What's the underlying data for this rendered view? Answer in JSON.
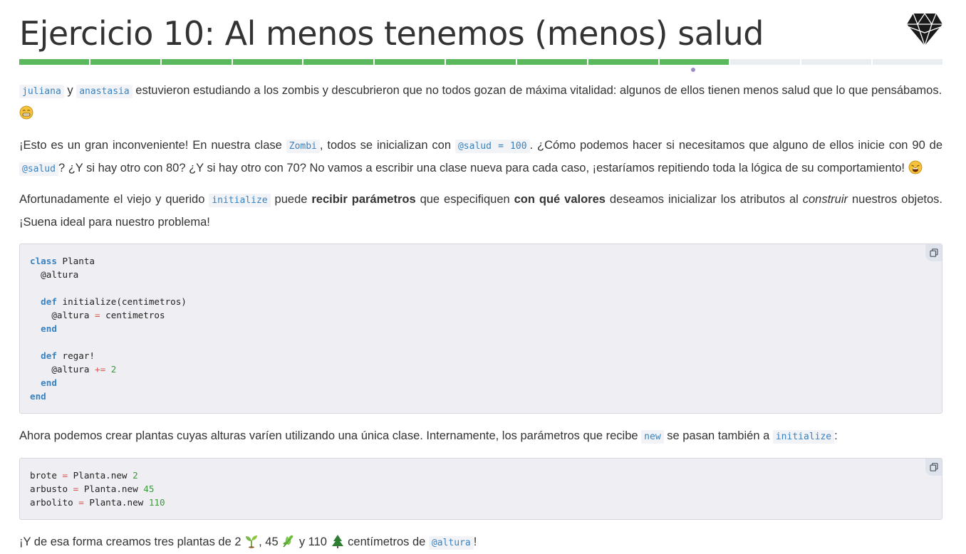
{
  "header": {
    "title": "Ejercicio 10: Al menos tenemos (menos) salud",
    "logo_icon": "ruby-gem-icon"
  },
  "progress": {
    "total_steps": 13,
    "completed_steps": 10,
    "current_step": 10,
    "done_color": "#5cb85c",
    "pending_color": "#eaeef0"
  },
  "intro": {
    "code1": "juliana",
    "t1": "y",
    "code2": "anastasia",
    "t2": "estuvieron estudiando a los zombis y descubrieron que no todos gozan de máxima vitalidad: algunos de ellos tienen menos salud que lo que pensábamos.",
    "emoji": "grimacing-face-icon"
  },
  "para2": {
    "t1": "¡Esto es un gran inconveniente! En nuestra clase",
    "code1": "Zombi",
    "t2": ", todos se inicializan con",
    "code2": "@salud = 100",
    "t3": ". ¿Cómo podemos hacer si necesitamos que alguno de ellos inicie con 90 de",
    "code3": "@salud",
    "t4": "? ¿Y si hay otro con 80? ¿Y si hay otro con 70? No vamos a escribir una clase nueva para cada caso, ¡estaríamos repitiendo toda la lógica de su comportamiento!",
    "emoji": "weary-face-icon"
  },
  "para3": {
    "t1": "Afortunadamente el viejo y querido",
    "code1": "initialize",
    "t2": "puede",
    "b1": "recibir parámetros",
    "t3": "que especifiquen",
    "b2": "con qué valores",
    "t4": "deseamos inicializar los atributos al",
    "i1": "construir",
    "t5": "nuestros objetos. ¡Suena ideal para nuestro problema!"
  },
  "code_block_1": {
    "l1_kw": "class",
    "l1_rest": " Planta",
    "l2": "  @altura",
    "l4_kw": "def",
    "l4_rest": " initialize(centimetros)",
    "l5_a": "    @altura ",
    "l5_op": "=",
    "l5_b": " centimetros",
    "l6_kw": "end",
    "l8_kw": "def",
    "l8_rest": " regar!",
    "l9_a": "    @altura ",
    "l9_op": "+=",
    "l9_num": "2",
    "l10_kw": "end",
    "l11_kw": "end"
  },
  "para4": {
    "t1": "Ahora podemos crear plantas cuyas alturas varíen utilizando una única clase. Internamente, los parámetros que recibe",
    "code1": "new",
    "t2": "se pasan también a",
    "code2": "initialize",
    "t3": ":"
  },
  "code_block_2": {
    "l1_a": "brote ",
    "l1_op": "=",
    "l1_b": " Planta.new ",
    "l1_num": "2",
    "l2_a": "arbusto ",
    "l2_op": "=",
    "l2_b": " Planta.new ",
    "l2_num": "45",
    "l3_a": "arbolito ",
    "l3_op": "=",
    "l3_b": " Planta.new ",
    "l3_num": "110"
  },
  "para5": {
    "t1": "¡Y de esa forma creamos tres plantas de 2",
    "t2": ", 45",
    "t3": "y 110",
    "t4": "centímetros de",
    "code1": "@altura",
    "t5": "!",
    "emoji1": "seedling-icon",
    "emoji2": "herb-icon",
    "emoji3": "evergreen-tree-icon"
  },
  "copy_icon": "copy-icon"
}
